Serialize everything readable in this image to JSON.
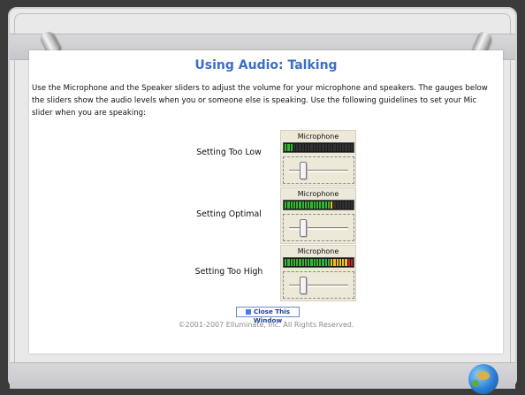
{
  "page": {
    "title": "Using Audio: Talking",
    "intro": "Use the Microphone and the Speaker sliders to adjust the volume for your microphone and speakers. The gauges below the sliders show the audio levels when you or someone else is speaking. Use the following guidelines to set your Mic slider when you are speaking:",
    "copyright": "©2001-2007 Elluminate, Inc. All Rights Reserved."
  },
  "settings": [
    {
      "label": "Setting Too Low",
      "gauge_label": "Microphone",
      "level_segments": 3,
      "total_segments": 24,
      "slider_value": 0.2
    },
    {
      "label": "Setting Optimal",
      "gauge_label": "Microphone",
      "level_segments": 17,
      "total_segments": 24,
      "slider_value": 0.2
    },
    {
      "label": "Setting Too High",
      "gauge_label": "Microphone",
      "level_segments": 24,
      "total_segments": 24,
      "slider_value": 0.2
    }
  ],
  "buttons": {
    "close_label": "Close This Window"
  },
  "colors": {
    "title": "#3a6ec8",
    "meter_green": "#2dbb2d",
    "meter_yellow": "#f2c40c",
    "meter_red": "#e11b1b"
  },
  "icons": {
    "pins": "pushpin-icon",
    "globe": "globe-icon",
    "close_button": "window-icon"
  }
}
